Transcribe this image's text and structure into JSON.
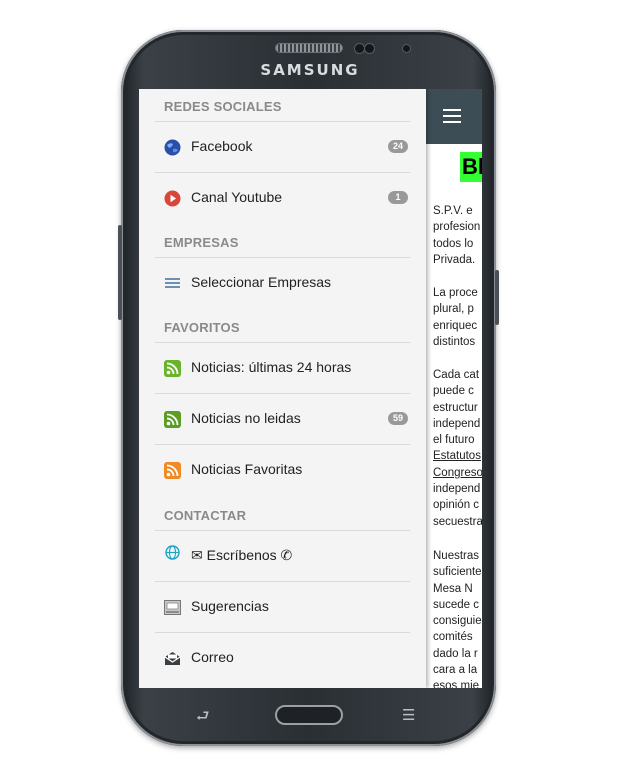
{
  "device": {
    "brand": "SAMSUNG",
    "back_glyph": "⮐",
    "menu_glyph": "☰"
  },
  "drawer": {
    "sections": [
      {
        "title": "REDES SOCIALES"
      },
      {
        "title": "EMPRESAS"
      },
      {
        "title": "FAVORITOS"
      },
      {
        "title": "CONTACTAR"
      }
    ],
    "items": [
      {
        "label": "Facebook",
        "count": "24",
        "icon": "globe-icon"
      },
      {
        "label": "Canal Youtube",
        "count": "1",
        "icon": "youtube-play-icon"
      },
      {
        "label": "Seleccionar Empresas",
        "icon": "list-icon"
      },
      {
        "label": "Noticias: últimas 24 horas",
        "icon": "rss-icon"
      },
      {
        "label": "Noticias no leidas",
        "count": "59",
        "icon": "rss-icon"
      },
      {
        "label": "Noticias Favoritas",
        "icon": "rss-icon"
      },
      {
        "label": "✉ Escríbenos ✆",
        "icon": "web-icon"
      },
      {
        "label": "Sugerencias",
        "icon": "suggestion-box-icon"
      },
      {
        "label": "Correo",
        "icon": "mail-icon"
      }
    ]
  },
  "content": {
    "heading": "Bl",
    "paragraphs": [
      [
        "S.P.V. e",
        "profesion",
        "todos lo",
        "Privada."
      ],
      [
        "La proce",
        "plural, p",
        "enriquec",
        "distintos"
      ],
      [
        "Cada cat",
        "puede c",
        "estructur",
        "independ",
        "el futuro",
        "Estatutos",
        "Congreso",
        "independ",
        "opinión c",
        "secuestra"
      ],
      [
        "Nuestras",
        "suficiente",
        "Mesa N",
        "sucede c",
        "consiguie",
        "comités",
        "dado la r",
        "cara a la",
        "esos mie"
      ]
    ]
  },
  "colors": {
    "appbar": "#3d4d56",
    "heading_bg": "#33ff33",
    "drawer_bg": "#f4f4f4",
    "badge": "#999999"
  }
}
